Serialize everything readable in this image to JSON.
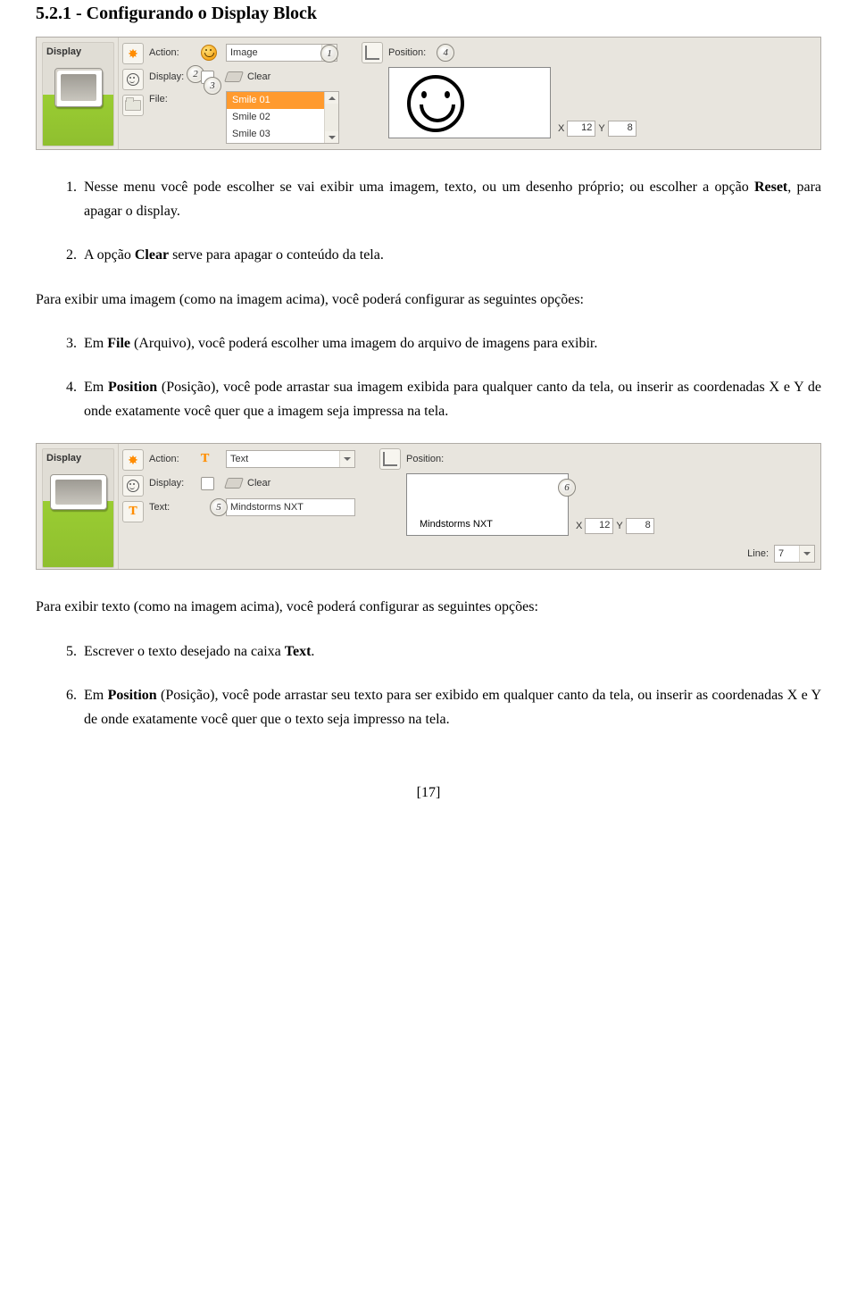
{
  "title": "5.2.1 - Configurando o Display Block",
  "panel1": {
    "sidebar_title": "Display",
    "action_label": "Action:",
    "action_value": "Image",
    "display_label": "Display:",
    "clear_label": "Clear",
    "file_label": "File:",
    "file_options": [
      "Smile 01",
      "Smile 02",
      "Smile 03"
    ],
    "position_label": "Position:",
    "x_label": "X",
    "x_value": "12",
    "y_label": "Y",
    "y_value": "8",
    "badges": {
      "b1": "1",
      "b2": "2",
      "b3": "3",
      "b4": "4"
    }
  },
  "para1_pre": "Nesse menu você pode escolher se vai exibir uma imagem, texto, ou um desenho próprio; ou escolher a opção ",
  "para1_bold1": "Reset",
  "para1_post1": ", para apagar o display.",
  "para2_pre": "A opção ",
  "para2_bold": "Clear",
  "para2_post": " serve para apagar o conteúdo da tela.",
  "para3": "Para exibir uma imagem (como na imagem acima), você poderá configurar as seguintes opções:",
  "para4_pre": "Em ",
  "para4_bold": "File",
  "para4_post": " (Arquivo), você poderá escolher uma imagem do arquivo de imagens para exibir.",
  "para5_pre": "Em ",
  "para5_bold": "Position",
  "para5_post": " (Posição), você pode arrastar sua imagem exibida para qualquer canto da tela, ou inserir as coordenadas X e Y de onde exatamente você quer que a imagem seja impressa na tela.",
  "panel2": {
    "sidebar_title": "Display",
    "action_label": "Action:",
    "action_value": "Text",
    "display_label": "Display:",
    "clear_label": "Clear",
    "text_label": "Text:",
    "text_value": "Mindstorms NXT",
    "position_label": "Position:",
    "preview_text": "Mindstorms NXT",
    "x_label": "X",
    "x_value": "12",
    "y_label": "Y",
    "y_value": "8",
    "line_label": "Line:",
    "line_value": "7",
    "badges": {
      "b5": "5",
      "b6": "6"
    }
  },
  "para6": "Para exibir texto (como na imagem acima), você poderá configurar as seguintes opções:",
  "para7_pre": "Escrever o texto desejado na caixa ",
  "para7_bold": "Text",
  "para7_post": ".",
  "para8_pre": "Em ",
  "para8_bold": "Position",
  "para8_post": " (Posição), você pode arrastar seu texto para ser exibido em qualquer canto da tela, ou inserir as coordenadas X e Y de onde exatamente você quer que o texto seja impresso na tela.",
  "pagenum": "[17]"
}
